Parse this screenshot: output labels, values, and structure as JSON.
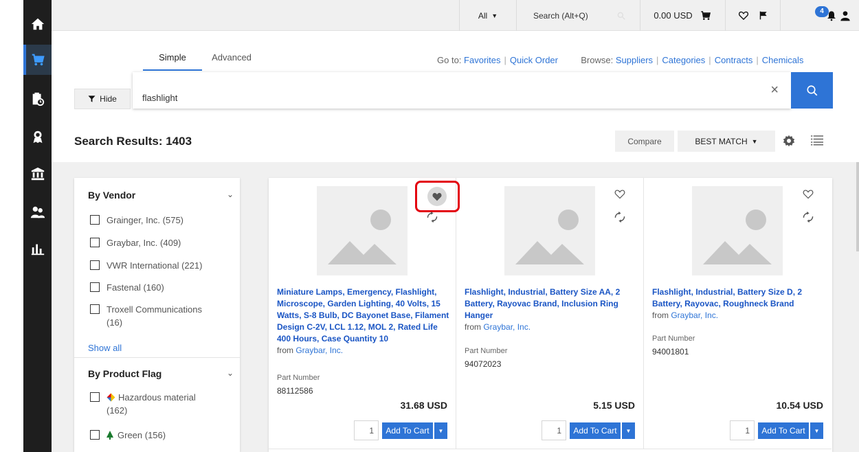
{
  "topbar": {
    "scope": "All",
    "search_placeholder": "Search (Alt+Q)",
    "cart_total": "0.00 USD",
    "notification_count": "4"
  },
  "search": {
    "tabs": [
      {
        "label": "Simple",
        "active": true
      },
      {
        "label": "Advanced",
        "active": false
      }
    ],
    "goto_label": "Go to:",
    "goto_links": [
      "Favorites",
      "Quick Order"
    ],
    "browse_label": "Browse:",
    "browse_links": [
      "Suppliers",
      "Categories",
      "Contracts",
      "Chemicals"
    ],
    "hide_label": "Hide",
    "query": "flashlight"
  },
  "results": {
    "title": "Search Results: 1403",
    "compare_label": "Compare",
    "sort_label": "BEST MATCH"
  },
  "filters": {
    "vendor_head": "By Vendor",
    "vendors": [
      "Grainger, Inc. (575)",
      "Graybar, Inc. (409)",
      "VWR International (221)",
      "Fastenal (160)",
      "Troxell Communications (16)"
    ],
    "show_all": "Show all",
    "flag_head": "By Product Flag",
    "flags": [
      "Hazardous material (162)",
      "Green (156)"
    ]
  },
  "products": [
    {
      "title": "Miniature Lamps, Emergency, Flashlight, Microscope, Garden Lighting, 40 Volts, 15 Watts, S-8 Bulb, DC Bayonet Base, Filament Design C-2V, LCL 1.12, MOL 2, Rated Life 400 Hours, Case Quantity 10",
      "from": "from",
      "vendor": "Graybar, Inc.",
      "part_label": "Part Number",
      "part": "88112586",
      "price": "31.68  USD",
      "qty": "1",
      "add_label": "Add To Cart",
      "favorited": true
    },
    {
      "title": "Flashlight, Industrial, Battery Size AA, 2 Battery, Rayovac Brand, Inclusion Ring Hanger",
      "from": "from",
      "vendor": "Graybar, Inc.",
      "part_label": "Part Number",
      "part": "94072023",
      "price": "5.15  USD",
      "qty": "1",
      "add_label": "Add To Cart",
      "favorited": false
    },
    {
      "title": "Flashlight, Industrial, Battery Size D, 2 Battery, Rayovac, Roughneck Brand",
      "from": "from",
      "vendor": "Graybar, Inc.",
      "part_label": "Part Number",
      "part": "94001801",
      "price": "10.54  USD",
      "qty": "1",
      "add_label": "Add To Cart",
      "favorited": false
    }
  ],
  "colors": {
    "accent": "#2e74d6",
    "nav_bg": "#1e1e1e",
    "highlight": "#e3000f"
  },
  "icons": {
    "nav": [
      "home-icon",
      "cart-icon",
      "history-icon",
      "award-icon",
      "bank-icon",
      "users-icon",
      "bar-chart-icon"
    ]
  }
}
